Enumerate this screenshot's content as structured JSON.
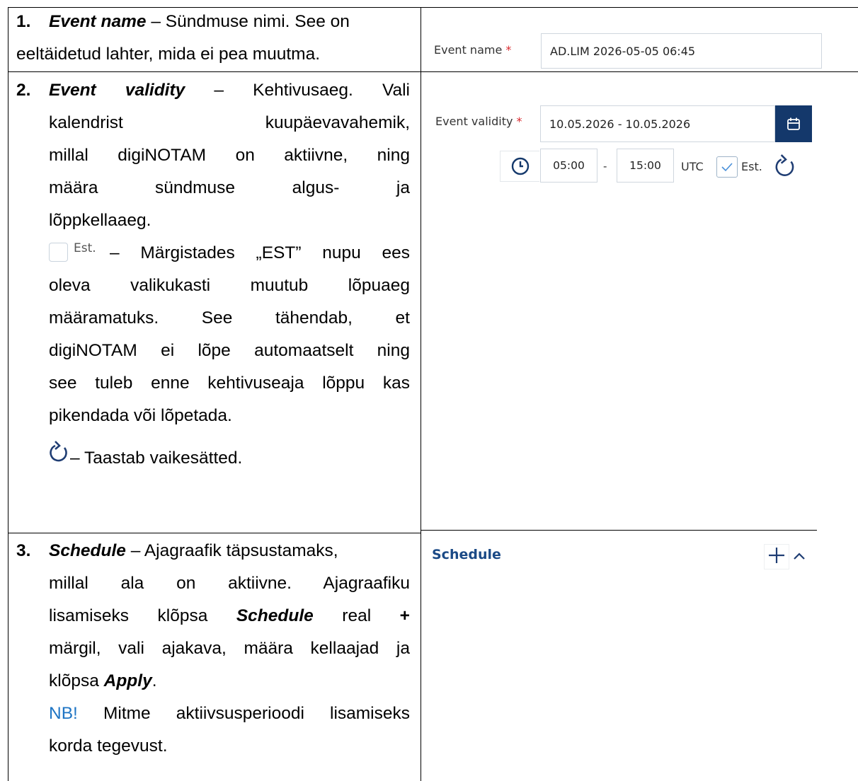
{
  "rows": [
    {
      "number": "1.",
      "title": "Event name",
      "lines": [
        "– Sündmuse nimi. See on",
        "eeltäidetud lahter, mida ei pea muutma."
      ],
      "ui": {
        "label": "Event name",
        "required_mark": "*",
        "value": "AD.LIM 2026-05-05 06:45"
      }
    },
    {
      "number": "2.",
      "title": "Event validity",
      "line1_rest": "– Kehtivusaeg.",
      "line1_end": "Vali",
      "lines": [
        "kalendrist kuupäevavahemik,",
        "millal digiNOTAM on aktiivne, ning",
        "määra sündmuse algus- ja",
        "lõppkellaaeg."
      ],
      "est_checkbox_label": "Est.",
      "est_lines": [
        "– Märgistades „EST” nupu ees",
        "oleva valikukasti muutub lõpuaeg",
        "määramatuks. See tähendab, et",
        "digiNOTAM ei lõpe automaatselt ning",
        "see tuleb enne kehtivuseaja lõppu kas",
        "pikendada või lõpetada."
      ],
      "reset_text": "– Taastab vaikesätted.",
      "ui": {
        "label": "Event validity",
        "required_mark": "*",
        "date_range": "10.05.2026 - 10.05.2026",
        "start_time": "05:00",
        "separator": "-",
        "end_time": "15:00",
        "timezone": "UTC",
        "est_label": "Est.",
        "est_checked": true
      }
    },
    {
      "number": "3.",
      "title": "Schedule",
      "line1_rest": "– Ajagraafik täpsustamaks,",
      "lines": [
        "millal ala on aktiivne. Ajagraafiku",
        "märgil, vali ajakava, määra kellaajad ja",
        "korda tegevust."
      ],
      "line3_pre": "lisamiseks klõpsa",
      "line3_bold": "Schedule",
      "line3_post": "real",
      "line3_plus": "+",
      "line5_pre": "klõpsa",
      "line5_bold": "Apply",
      "line5_post": ".",
      "note_label": "NB!",
      "note_rest": "Mitme aktiivsusperioodi lisamiseks",
      "ui": {
        "title": "Schedule",
        "add_symbol": "+",
        "collapse_symbol": "^"
      }
    }
  ],
  "colors": {
    "accent_blue": "#1f75c4",
    "button_navy": "#14386b",
    "required_red": "#d9292e"
  }
}
